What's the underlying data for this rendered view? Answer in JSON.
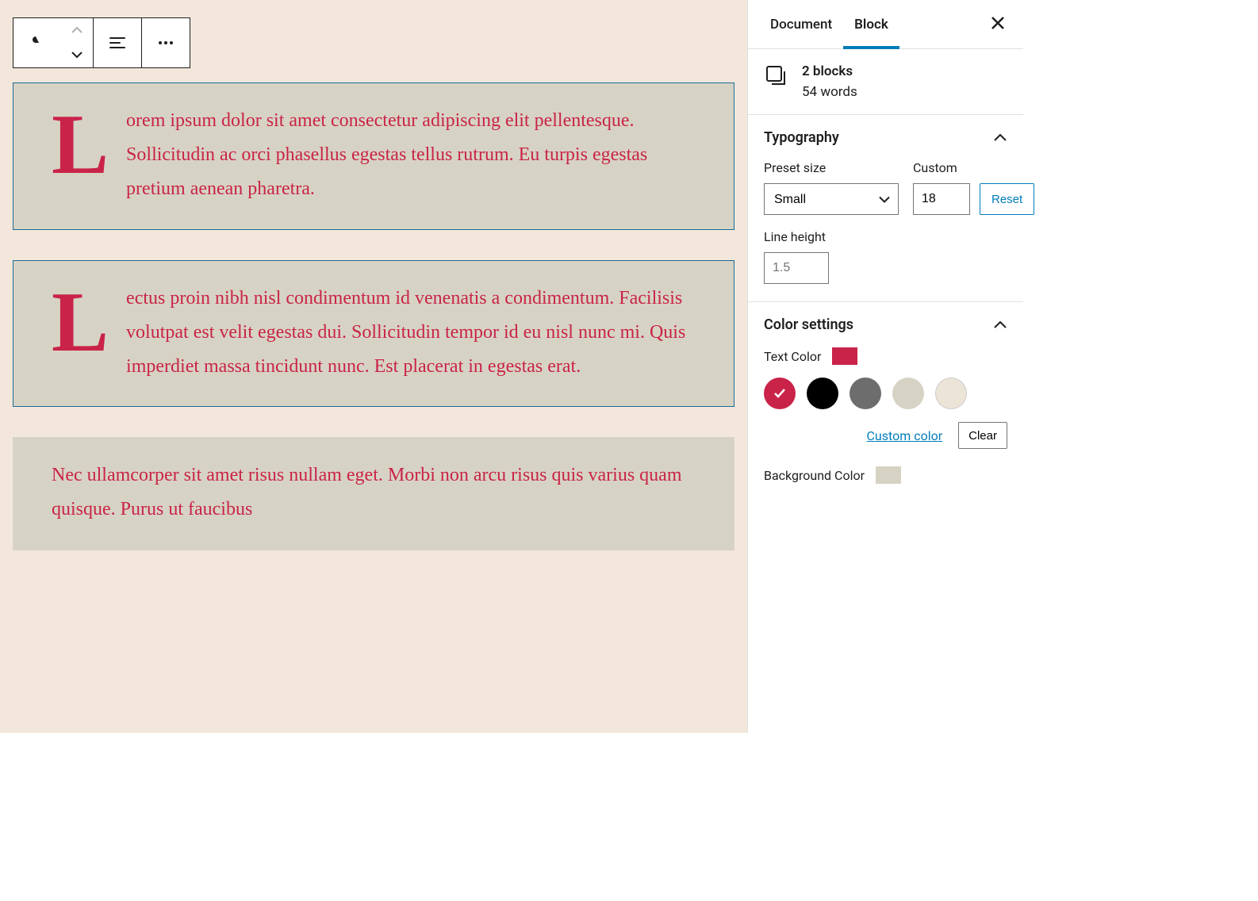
{
  "toolbar": {
    "block_type": "paragraph",
    "align": "left"
  },
  "blocks": [
    "Lorem ipsum dolor sit amet consectetur adipiscing elit pellentesque. Sollicitudin ac orci phasellus egestas tellus rutrum. Eu turpis egestas pretium aenean pharetra.",
    "Lectus proin nibh nisl condimentum id venenatis a condimentum. Facilisis volutpat est velit egestas dui. Sollicitudin tempor id eu nisl nunc mi. Quis imperdiet massa tincidunt nunc. Est placerat in egestas erat.",
    "Nec ullamcorper sit amet risus nullam eget. Morbi non arcu risus quis varius quam quisque. Purus ut faucibus"
  ],
  "sidebar": {
    "tabs": {
      "document": "Document",
      "block": "Block",
      "active": "block"
    },
    "block_card": {
      "title": "2 blocks",
      "sub": "54 words"
    },
    "typography": {
      "title": "Typography",
      "preset_label": "Preset size",
      "preset_value": "Small",
      "custom_label": "Custom",
      "custom_value": "18",
      "reset": "Reset",
      "lineheight_label": "Line height",
      "lineheight_value": "1.5"
    },
    "color": {
      "title": "Color settings",
      "text_label": "Text Color",
      "text_swatch": "#c9234a",
      "palette": [
        {
          "hex": "#c9234a",
          "selected": true
        },
        {
          "hex": "#000000",
          "selected": false
        },
        {
          "hex": "#6d6d6d",
          "selected": false
        },
        {
          "hex": "#d7d3c4",
          "selected": false
        },
        {
          "hex": "#ece4d7",
          "selected": false
        }
      ],
      "custom_link": "Custom color",
      "clear": "Clear",
      "bg_label": "Background Color",
      "bg_swatch": "#d7d3c4"
    }
  }
}
